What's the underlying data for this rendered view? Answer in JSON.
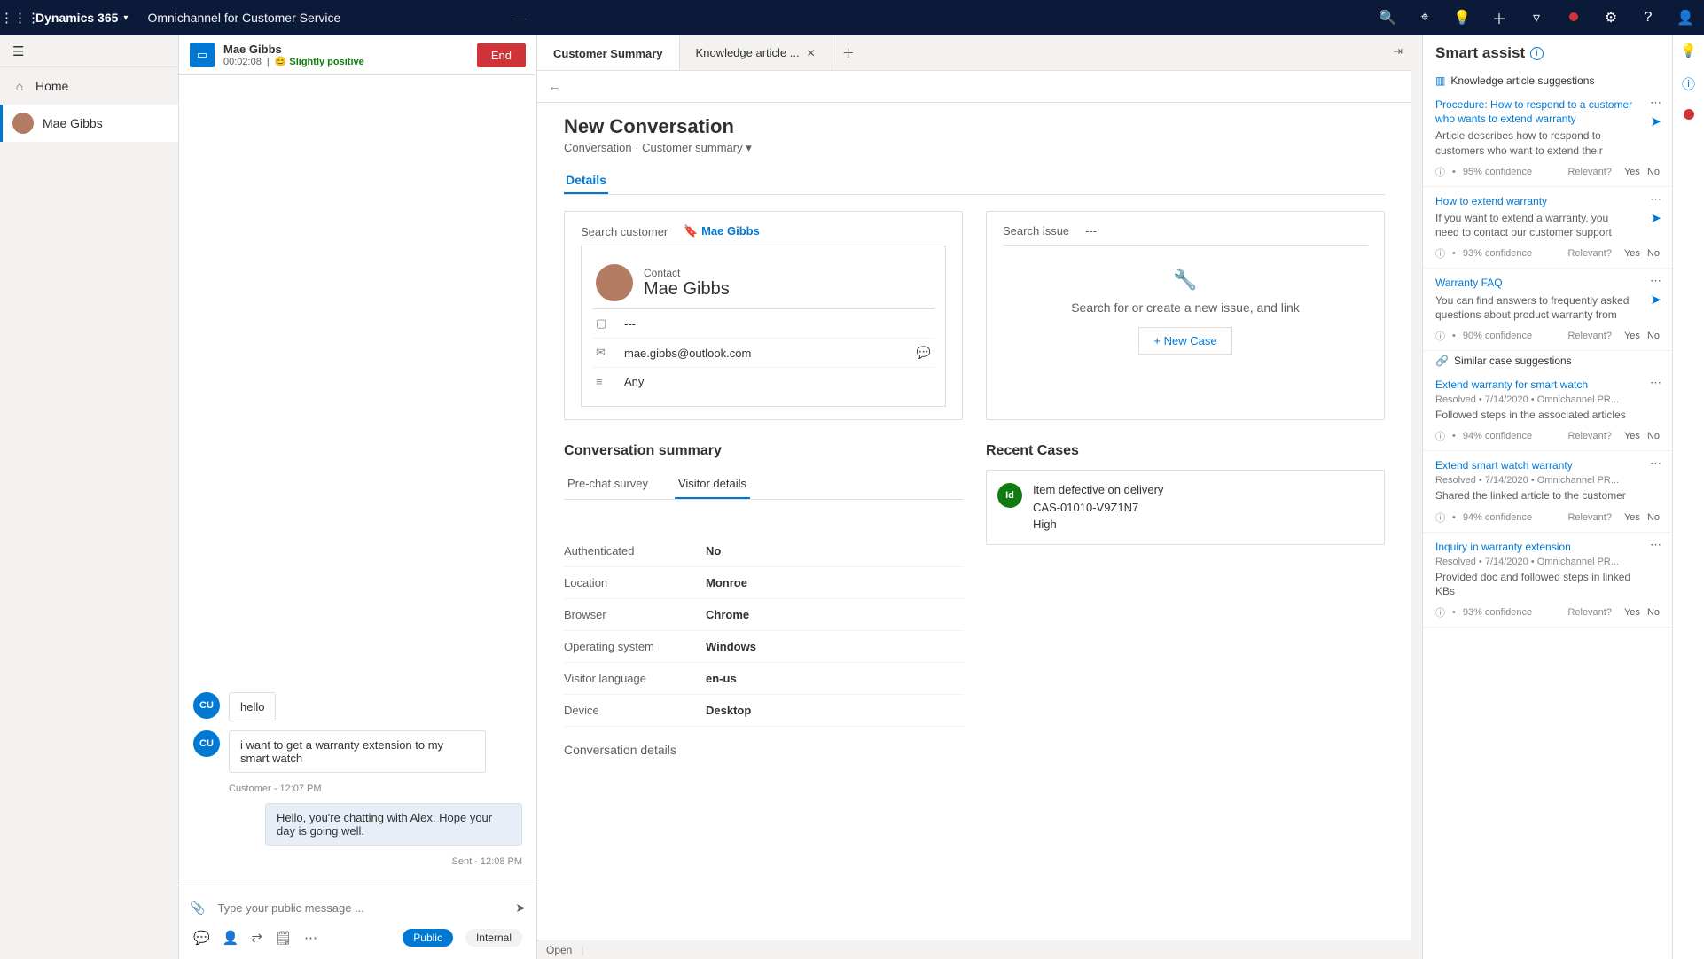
{
  "topbar": {
    "brand": "Dynamics 365",
    "app": "Omnichannel for Customer Service"
  },
  "nav": {
    "home": "Home",
    "session": "Mae Gibbs"
  },
  "chat": {
    "name": "Mae Gibbs",
    "timer": "00:02:08",
    "sentiment": "Slightly positive",
    "end": "End",
    "messages": [
      {
        "who": "cu",
        "av": "CU",
        "text": "hello"
      },
      {
        "who": "cu",
        "av": "CU",
        "text": "i want to get a warranty extension to my smart watch"
      }
    ],
    "ts1": "Customer - 12:07 PM",
    "agentmsg": "Hello, you're chatting with Alex. Hope your day is going well.",
    "ts2": "Sent - 12:08 PM",
    "placeholder": "Type your public message ...",
    "public": "Public",
    "internal": "Internal"
  },
  "tabs": {
    "t1": "Customer Summary",
    "t2": "Knowledge article ..."
  },
  "page": {
    "title": "New Conversation",
    "sub1": "Conversation",
    "sub2": "Customer summary",
    "details": "Details",
    "searchCust": "Search customer",
    "custLink": "Mae Gibbs",
    "contactLbl": "Contact",
    "contactName": "Mae Gibbs",
    "dash": "---",
    "email": "mae.gibbs@outlook.com",
    "any": "Any",
    "searchIssue": "Search issue",
    "issueDash": "---",
    "issueHelp": "Search for or create a new issue, and link",
    "newCase": "+ New Case",
    "convSum": "Conversation summary",
    "prechat": "Pre-chat survey",
    "visitor": "Visitor details",
    "kv": [
      {
        "k": "Authenticated",
        "v": "No"
      },
      {
        "k": "Location",
        "v": "Monroe"
      },
      {
        "k": "Browser",
        "v": "Chrome"
      },
      {
        "k": "Operating system",
        "v": "Windows"
      },
      {
        "k": "Visitor language",
        "v": "en-us"
      },
      {
        "k": "Device",
        "v": "Desktop"
      }
    ],
    "recent": "Recent Cases",
    "case": {
      "title": "Item defective on delivery",
      "num": "CAS-01010-V9Z1N7",
      "pri": "High"
    },
    "convdet": "Conversation details",
    "status": "Open"
  },
  "smart": {
    "title": "Smart assist",
    "kbhdr": "Knowledge article suggestions",
    "simhdr": "Similar case suggestions",
    "relevant": "Relevant?",
    "yes": "Yes",
    "no": "No",
    "kb": [
      {
        "t": "Procedure: How to respond to a customer who wants to extend warranty",
        "d": "Article describes how to respond to customers who want to extend their",
        "c": "95% confidence"
      },
      {
        "t": "How to extend warranty",
        "d": "If you want to extend a warranty, you need to contact our customer support",
        "c": "93% confidence"
      },
      {
        "t": "Warranty FAQ",
        "d": "You can find answers to frequently asked questions about product warranty from",
        "c": "90% confidence"
      }
    ],
    "cases": [
      {
        "t": "Extend warranty for smart watch",
        "m": "Resolved • 7/14/2020 • Omnichannel PR...",
        "d": "Followed steps in the associated articles",
        "c": "94% confidence"
      },
      {
        "t": "Extend smart watch warranty",
        "m": "Resolved • 7/14/2020 • Omnichannel PR...",
        "d": "Shared the linked article to the customer",
        "c": "94% confidence"
      },
      {
        "t": "Inquiry in warranty extension",
        "m": "Resolved • 7/14/2020 • Omnichannel PR...",
        "d": "Provided doc and followed steps in linked KBs",
        "c": "93% confidence"
      }
    ]
  }
}
